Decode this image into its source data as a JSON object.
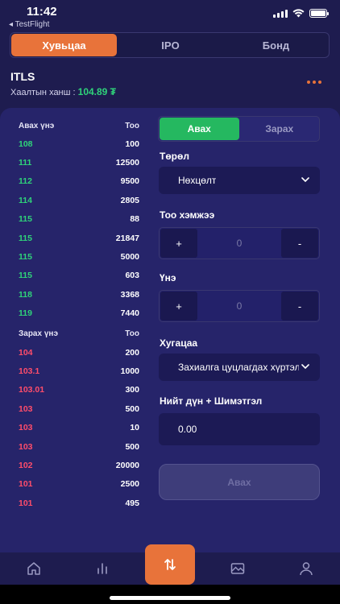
{
  "status": {
    "time": "11:42",
    "back_app": "◂ TestFlight"
  },
  "top_tabs": [
    "Хувьцаа",
    "IPO",
    "Бонд"
  ],
  "stock": {
    "ticker": "ITLS",
    "close_label": "Хаалтын ханш :",
    "close_value": "104.89 ₮"
  },
  "order_book": {
    "buy_header": {
      "price": "Авах үнэ",
      "qty": "Тоо"
    },
    "buy_rows": [
      {
        "price": "108",
        "qty": "100"
      },
      {
        "price": "111",
        "qty": "12500"
      },
      {
        "price": "112",
        "qty": "9500"
      },
      {
        "price": "114",
        "qty": "2805"
      },
      {
        "price": "115",
        "qty": "88"
      },
      {
        "price": "115",
        "qty": "21847"
      },
      {
        "price": "115",
        "qty": "5000"
      },
      {
        "price": "115",
        "qty": "603"
      },
      {
        "price": "118",
        "qty": "3368"
      },
      {
        "price": "119",
        "qty": "7440"
      }
    ],
    "sell_header": {
      "price": "Зарах үнэ",
      "qty": "Тоо"
    },
    "sell_rows": [
      {
        "price": "104",
        "qty": "200"
      },
      {
        "price": "103.1",
        "qty": "1000"
      },
      {
        "price": "103.01",
        "qty": "300"
      },
      {
        "price": "103",
        "qty": "500"
      },
      {
        "price": "103",
        "qty": "10"
      },
      {
        "price": "103",
        "qty": "500"
      },
      {
        "price": "102",
        "qty": "20000"
      },
      {
        "price": "101",
        "qty": "2500"
      },
      {
        "price": "101",
        "qty": "495"
      }
    ]
  },
  "form": {
    "side_tabs": {
      "buy": "Авах",
      "sell": "Зарах"
    },
    "type_label": "Төрөл",
    "type_value": "Нөхцөлт",
    "qty_label": "Тоо хэмжээ",
    "qty_value": "0",
    "price_label": "Үнэ",
    "price_value": "0",
    "plus": "+",
    "minus": "-",
    "term_label": "Хугацаа",
    "term_value": "Захиалга цуцлагдах хүртэл",
    "total_label": "Нийт дүн + Шимэтгэл",
    "total_value": "0.00",
    "submit": "Авах"
  },
  "colors": {
    "accent": "#e8733a",
    "buy": "#2fd37a",
    "sell": "#ff4d6a",
    "background": "#1e1c4f",
    "panel": "#26246a"
  },
  "bottom_nav": [
    "home-icon",
    "chart-bars-icon",
    "swap-icon",
    "image-icon",
    "profile-icon"
  ]
}
